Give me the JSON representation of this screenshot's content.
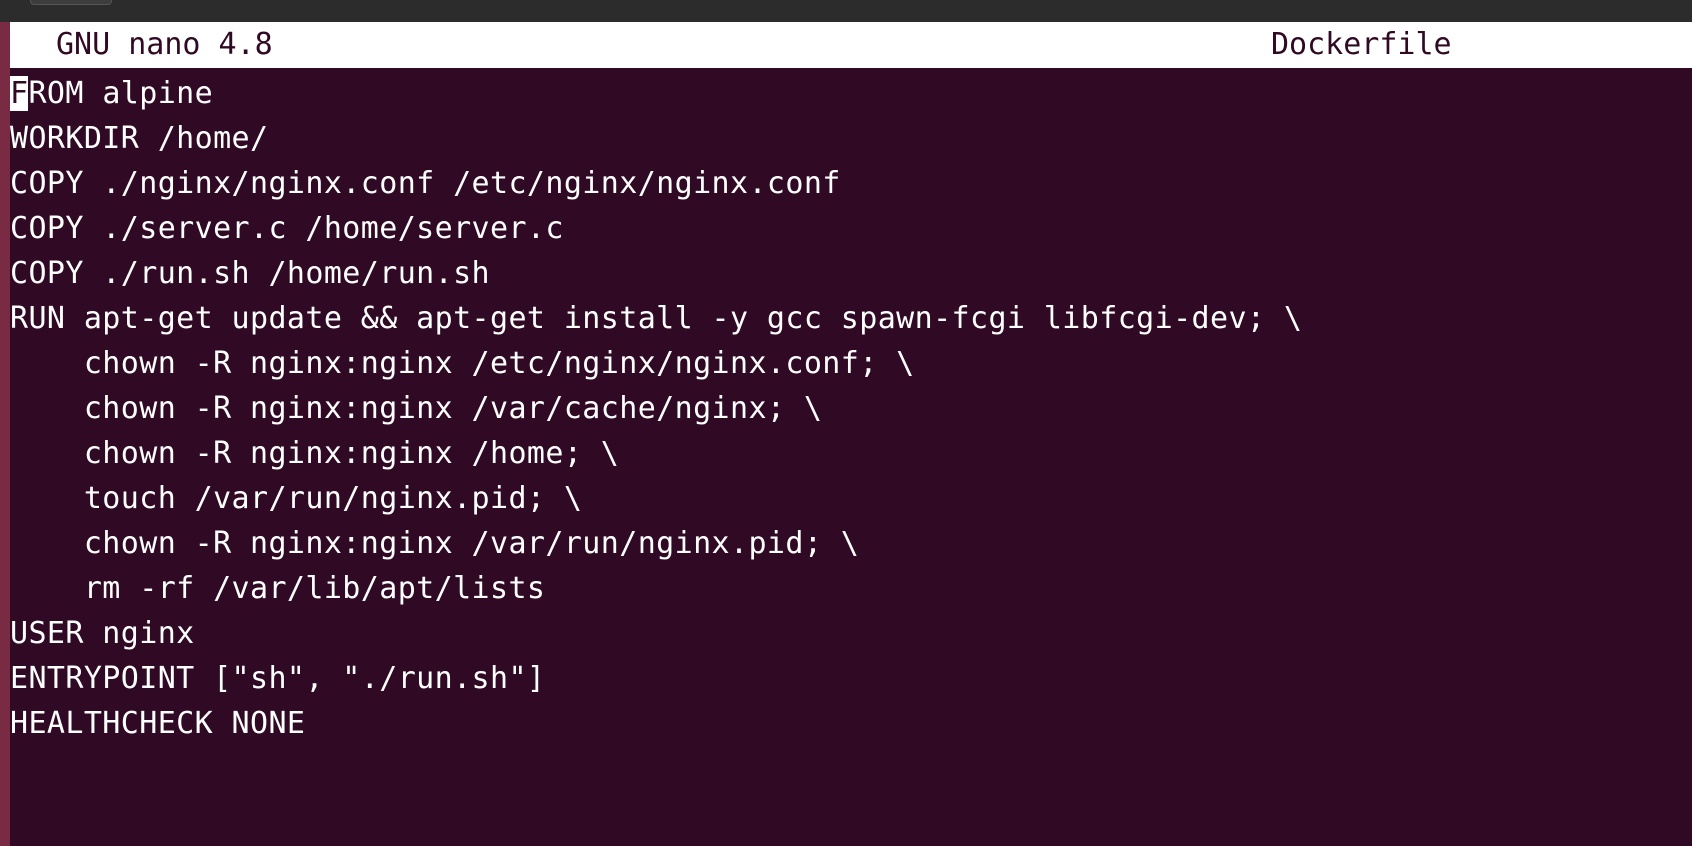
{
  "editor": {
    "app_version": "GNU nano 4.8",
    "file_name": "Dockerfile",
    "cursor_char": "F",
    "first_line_rest": "ROM alpine",
    "lines": [
      "WORKDIR /home/",
      "COPY ./nginx/nginx.conf /etc/nginx/nginx.conf",
      "COPY ./server.c /home/server.c",
      "COPY ./run.sh /home/run.sh",
      "RUN apt-get update && apt-get install -y gcc spawn-fcgi libfcgi-dev; \\",
      "    chown -R nginx:nginx /etc/nginx/nginx.conf; \\",
      "    chown -R nginx:nginx /var/cache/nginx; \\",
      "    chown -R nginx:nginx /home; \\",
      "    touch /var/run/nginx.pid; \\",
      "    chown -R nginx:nginx /var/run/nginx.pid; \\",
      "    rm -rf /var/lib/apt/lists",
      "USER nginx",
      "ENTRYPOINT [\"sh\", \"./run.sh\"]",
      "HEALTHCHECK NONE"
    ]
  },
  "colors": {
    "terminal_bg": "#300a24",
    "text": "#ffffff",
    "titlebar_bg": "#ffffff"
  }
}
